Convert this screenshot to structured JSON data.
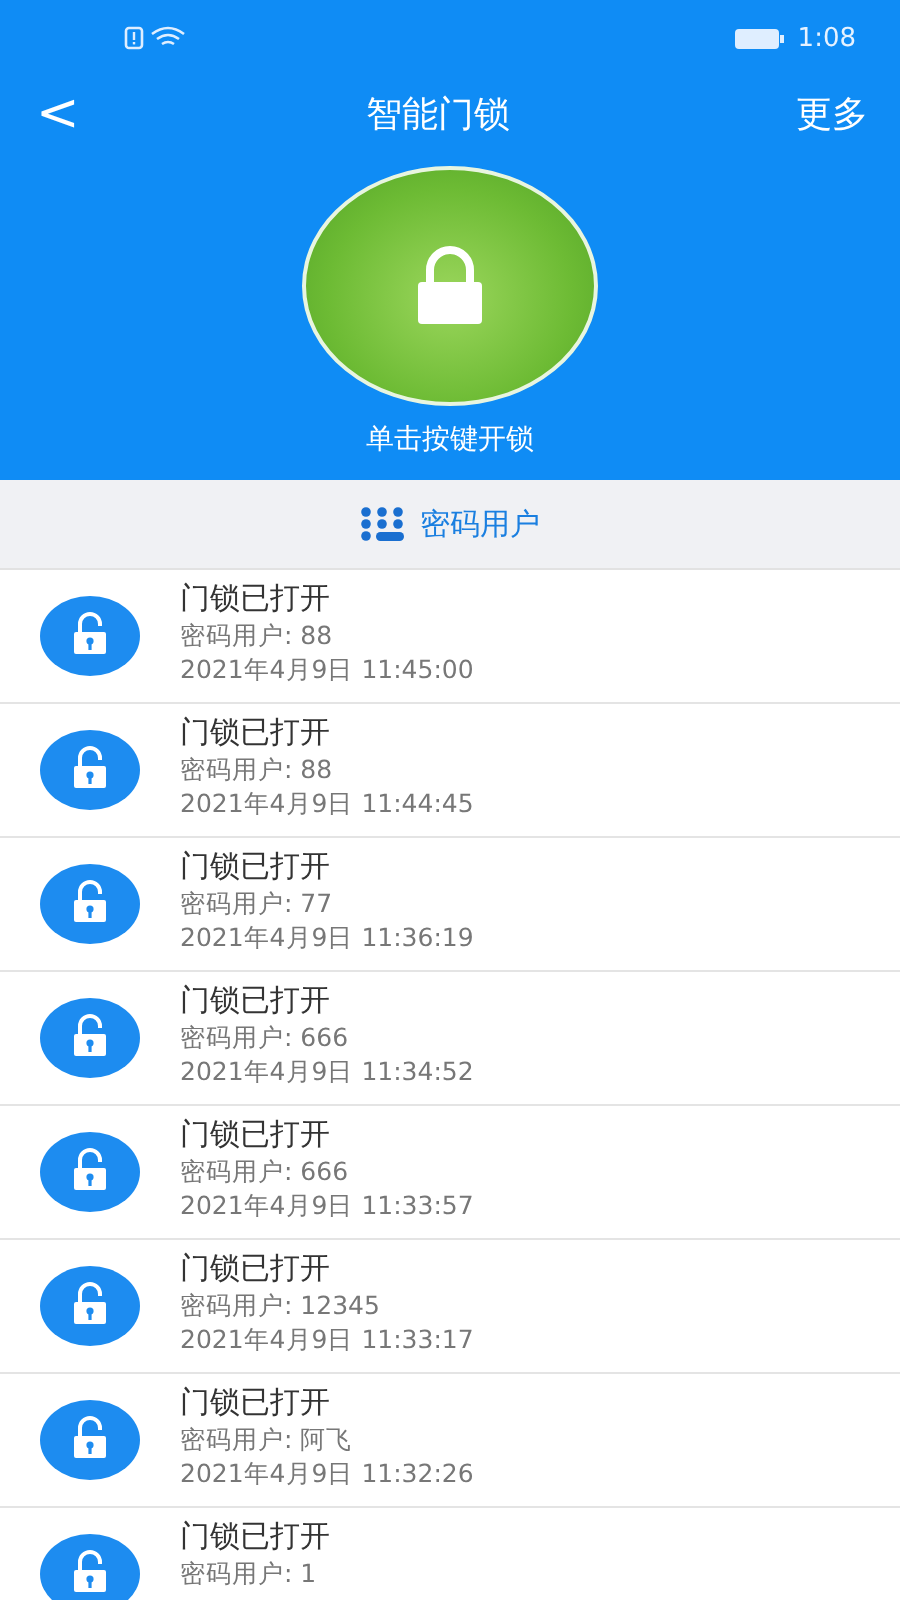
{
  "status_bar": {
    "time": "1:08"
  },
  "nav": {
    "back": "<",
    "title": "智能门锁",
    "more": "更多"
  },
  "unlock": {
    "caption": "单击按键开锁"
  },
  "tab": {
    "label": "密码用户"
  },
  "records": [
    {
      "title": "门锁已打开",
      "user": "密码用户: 88",
      "time": "2021年4月9日 11:45:00"
    },
    {
      "title": "门锁已打开",
      "user": "密码用户: 88",
      "time": "2021年4月9日 11:44:45"
    },
    {
      "title": "门锁已打开",
      "user": "密码用户: 77",
      "time": "2021年4月9日 11:36:19"
    },
    {
      "title": "门锁已打开",
      "user": "密码用户: 666",
      "time": "2021年4月9日 11:34:52"
    },
    {
      "title": "门锁已打开",
      "user": "密码用户: 666",
      "time": "2021年4月9日 11:33:57"
    },
    {
      "title": "门锁已打开",
      "user": "密码用户: 12345",
      "time": "2021年4月9日 11:33:17"
    },
    {
      "title": "门锁已打开",
      "user": "密码用户: 阿飞",
      "time": "2021年4月9日 11:32:26"
    },
    {
      "title": "门锁已打开",
      "user": "密码用户: 1"
    }
  ]
}
